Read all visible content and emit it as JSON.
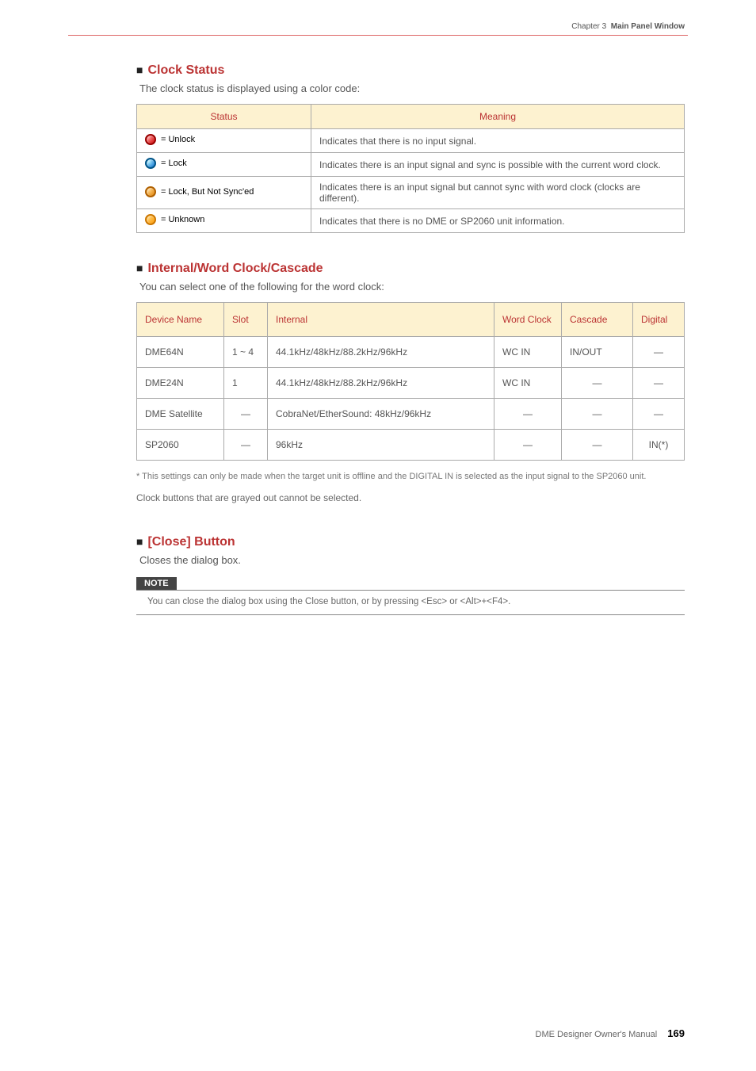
{
  "chapter": {
    "prefix": "Chapter 3",
    "title": "Main Panel Window"
  },
  "clockStatus": {
    "title": "Clock Status",
    "desc": "The clock status is displayed using a color code:",
    "headers": {
      "status": "Status",
      "meaning": "Meaning"
    },
    "rows": [
      {
        "label": "= Unlock",
        "dot": "red",
        "meaning": "Indicates that there is no input signal."
      },
      {
        "label": "= Lock",
        "dot": "blue",
        "meaning": "Indicates there is an input signal and sync is possible with the current word clock."
      },
      {
        "label": "= Lock, But Not Sync'ed",
        "dot": "orange-amber",
        "meaning": "Indicates there is an input signal but cannot sync with word clock (clocks are different)."
      },
      {
        "label": "= Unknown",
        "dot": "orange",
        "meaning": "Indicates that there is no DME or SP2060 unit information."
      }
    ]
  },
  "internalWord": {
    "title": "Internal/Word Clock/Cascade",
    "desc": "You can select one of the following for the word clock:",
    "headers": {
      "device": "Device Name",
      "slot": "Slot",
      "internal": "Internal",
      "word": "Word Clock",
      "cascade": "Cascade",
      "digital": "Digital"
    },
    "rows": [
      {
        "device": "DME64N",
        "slot": "1 ~ 4",
        "internal": "44.1kHz/48kHz/88.2kHz/96kHz",
        "word": "WC IN",
        "cascade": "IN/OUT",
        "digital": "—"
      },
      {
        "device": "DME24N",
        "slot": "1",
        "internal": "44.1kHz/48kHz/88.2kHz/96kHz",
        "word": "WC IN",
        "cascade": "—",
        "digital": "—"
      },
      {
        "device": "DME Satellite",
        "slot": "—",
        "internal": "CobraNet/EtherSound: 48kHz/96kHz",
        "word": "—",
        "cascade": "—",
        "digital": "—"
      },
      {
        "device": "SP2060",
        "slot": "—",
        "internal": "96kHz",
        "word": "—",
        "cascade": "—",
        "digital": "IN(*)"
      }
    ],
    "footnote": "* This settings can only be made when the target unit is offline and the DIGITAL IN is selected as the input signal to the SP2060 unit.",
    "greynote": "Clock buttons that are grayed out cannot be selected."
  },
  "closeButton": {
    "title": "[Close] Button",
    "desc": "Closes the dialog box.",
    "noteLabel": "NOTE",
    "noteText": "You can close the dialog box using the Close button, or by pressing <Esc> or <Alt>+<F4>."
  },
  "footer": {
    "manual": "DME Designer Owner's Manual",
    "page": "169"
  }
}
